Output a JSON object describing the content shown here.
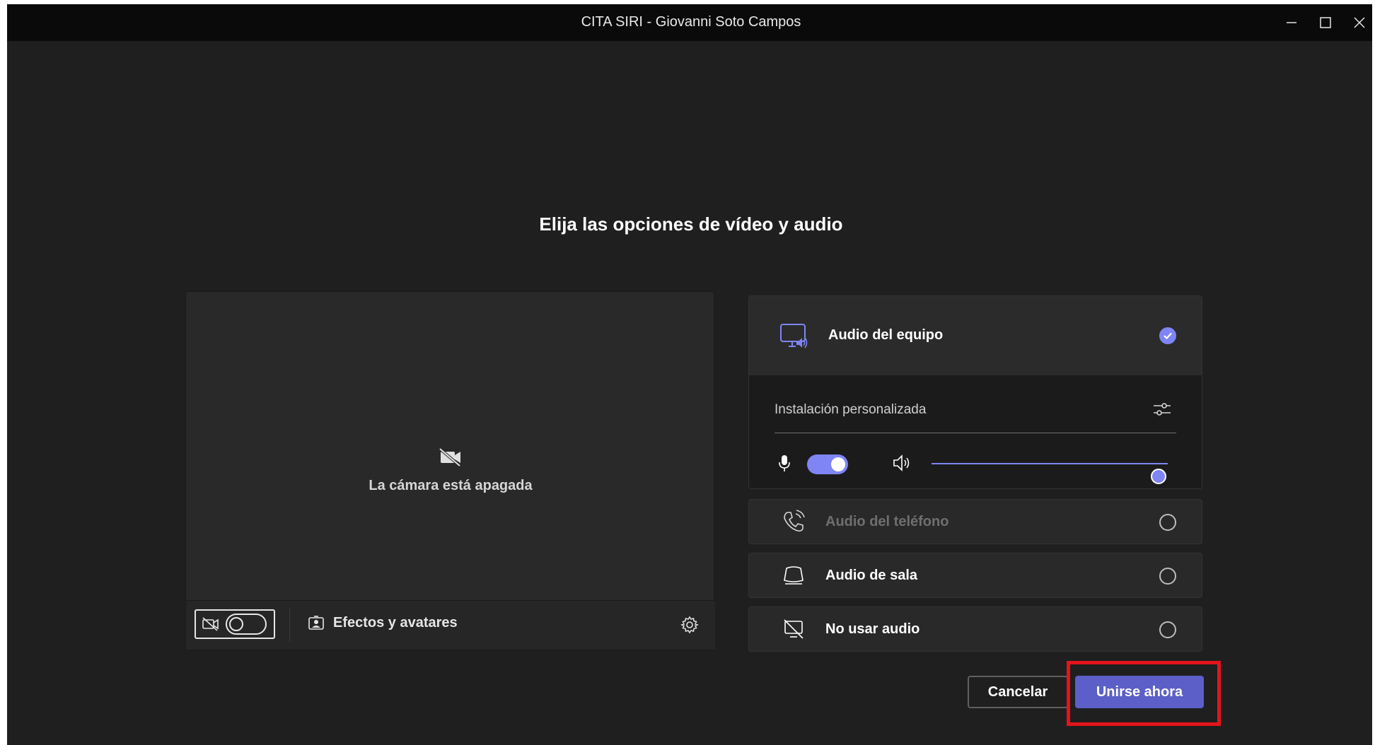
{
  "window": {
    "title": "CITA SIRI - Giovanni Soto Campos",
    "controls": [
      "minimize-icon",
      "maximize-icon",
      "close-icon"
    ]
  },
  "heading": "Elija las opciones de vídeo y audio",
  "video": {
    "camera_off_text": "La cámara está apagada",
    "camera_toggle_on": false,
    "effects_label": "Efectos y avatares"
  },
  "audio": {
    "computer_audio": {
      "label": "Audio del equipo",
      "selected": true
    },
    "custom_setup_label": "Instalación personalizada",
    "mic_on": true,
    "speaker_volume": 1.0,
    "phone_audio": {
      "label": "Audio del teléfono",
      "selected": false,
      "disabled": true
    },
    "room_audio": {
      "label": "Audio de sala",
      "selected": false
    },
    "no_audio": {
      "label": "No usar audio",
      "selected": false
    }
  },
  "buttons": {
    "cancel": "Cancelar",
    "join": "Unirse ahora"
  },
  "colors": {
    "accent": "#7f85f5",
    "join_button": "#5b5fc7",
    "highlight": "#e3141c",
    "background": "#1f1f1f"
  }
}
